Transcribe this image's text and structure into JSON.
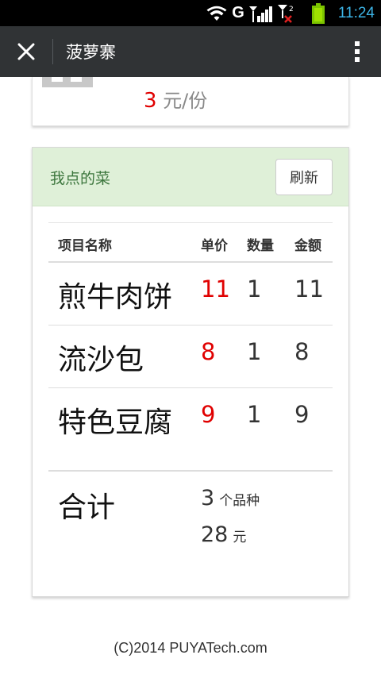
{
  "status_bar": {
    "network_label": "G",
    "time": "11:24"
  },
  "title_bar": {
    "title": "菠萝寨"
  },
  "top_card": {
    "price_number": "3",
    "price_unit": "元/份"
  },
  "order_card": {
    "title": "我点的菜",
    "refresh_label": "刷新",
    "table": {
      "headers": {
        "name": "项目名称",
        "price": "单价",
        "qty": "数量",
        "amount": "金额"
      },
      "rows": [
        {
          "name": "煎牛肉饼",
          "price": "11",
          "qty": "1",
          "amount": "11"
        },
        {
          "name": "流沙包",
          "price": "8",
          "qty": "1",
          "amount": "8"
        },
        {
          "name": "特色豆腐",
          "price": "9",
          "qty": "1",
          "amount": "9"
        }
      ]
    },
    "total": {
      "label": "合计",
      "count": "3",
      "count_unit": "个品种",
      "sum": "28",
      "sum_unit": "元"
    }
  },
  "footer": {
    "copyright": "(C)2014 PUYATech.com"
  },
  "colors": {
    "title_bar_bg": "#303335",
    "header_bg": "#dff0d8",
    "header_text": "#3c763d",
    "price_red": "#e00000",
    "status_blue": "#3cb4e6"
  }
}
